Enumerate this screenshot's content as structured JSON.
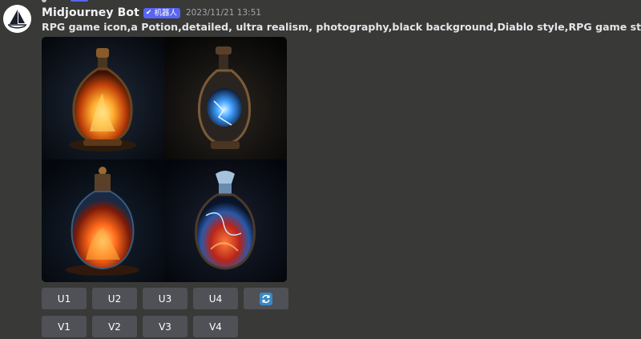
{
  "author": {
    "name": "Midjourney Bot",
    "badge_label": "机器人",
    "badge_icon": "checkmark-icon"
  },
  "timestamp": "2023/11/21 13:51",
  "prompt": "RPG game icon,a Potion,detailed, ultra realism, photography,black background,Diablo style,RPG game style,nature light -",
  "image_grid": {
    "tiles": [
      {
        "subject": "potion-flask",
        "glow": "orange-fire",
        "accent": "#ff8a1f"
      },
      {
        "subject": "potion-flask",
        "glow": "blue-lightning",
        "accent": "#3fa0ff"
      },
      {
        "subject": "potion-flask",
        "glow": "orange-fire",
        "accent": "#ff6a1a"
      },
      {
        "subject": "potion-flask",
        "glow": "blue-red",
        "accent": "#4aa0ff"
      }
    ]
  },
  "buttons": {
    "upscale": [
      "U1",
      "U2",
      "U3",
      "U4"
    ],
    "variation": [
      "V1",
      "V2",
      "V3",
      "V4"
    ],
    "reroll_icon": "refresh-icon"
  },
  "colors": {
    "background": "#393937",
    "button": "#4f5156",
    "badge": "#5865f2",
    "reroll": "#3b88c3"
  }
}
